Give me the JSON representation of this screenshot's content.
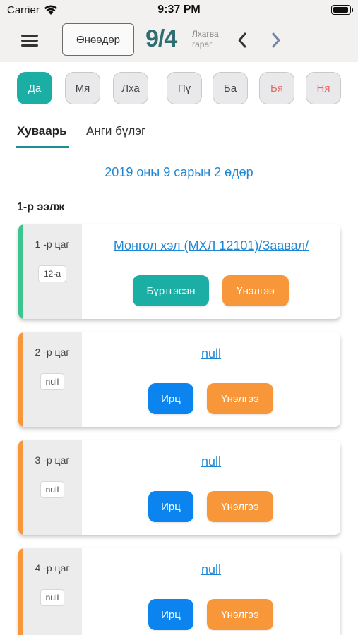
{
  "status_bar": {
    "carrier": "Carrier",
    "time": "9:37 PM"
  },
  "header": {
    "today_label": "Өнөөдөр",
    "date": "9/4",
    "weekday_line1": "Лхагва",
    "weekday_line2": "гараг",
    "icons": {
      "menu": "hamburger-menu-icon",
      "prev": "chevron-left-icon",
      "next": "chevron-right-icon"
    }
  },
  "days": [
    {
      "label": "Да",
      "active": true,
      "weekend": false
    },
    {
      "label": "Мя",
      "active": false,
      "weekend": false
    },
    {
      "label": "Лха",
      "active": false,
      "weekend": false
    },
    {
      "label": "Пү",
      "active": false,
      "weekend": false
    },
    {
      "label": "Ба",
      "active": false,
      "weekend": false
    },
    {
      "label": "Бя",
      "active": false,
      "weekend": true
    },
    {
      "label": "Ня",
      "active": false,
      "weekend": true
    }
  ],
  "tabs": {
    "schedule": "Хуваарь",
    "class_group": "Анги бүлэг"
  },
  "date_text": "2019 оны 9 сарын 2 өдөр",
  "shift_title": "1-р ээлж",
  "periods": [
    {
      "label": "1 -р цаг",
      "class": "12-а",
      "subject": "Монгол хэл (МХЛ 12101)/Заавал/",
      "primary": "Бүртгэсэн",
      "secondary": "Үнэлгээ"
    },
    {
      "label": "2 -р цаг",
      "class": "null",
      "subject": "null",
      "primary": "Ирц",
      "secondary": "Үнэлгээ"
    },
    {
      "label": "3 -р цаг",
      "class": "null",
      "subject": "null",
      "primary": "Ирц",
      "secondary": "Үнэлгээ"
    },
    {
      "label": "4 -р цаг",
      "class": "null",
      "subject": "null",
      "primary": "Ирц",
      "secondary": "Үнэлгээ"
    }
  ],
  "colors": {
    "accent_teal": "#1aaea4",
    "orange": "#f7973a",
    "blue": "#0b84f0",
    "link": "#1e88d6",
    "weekend": "#e46a6a",
    "bar_registered": "#3ec48f",
    "bar_pending": "#f7973a"
  }
}
